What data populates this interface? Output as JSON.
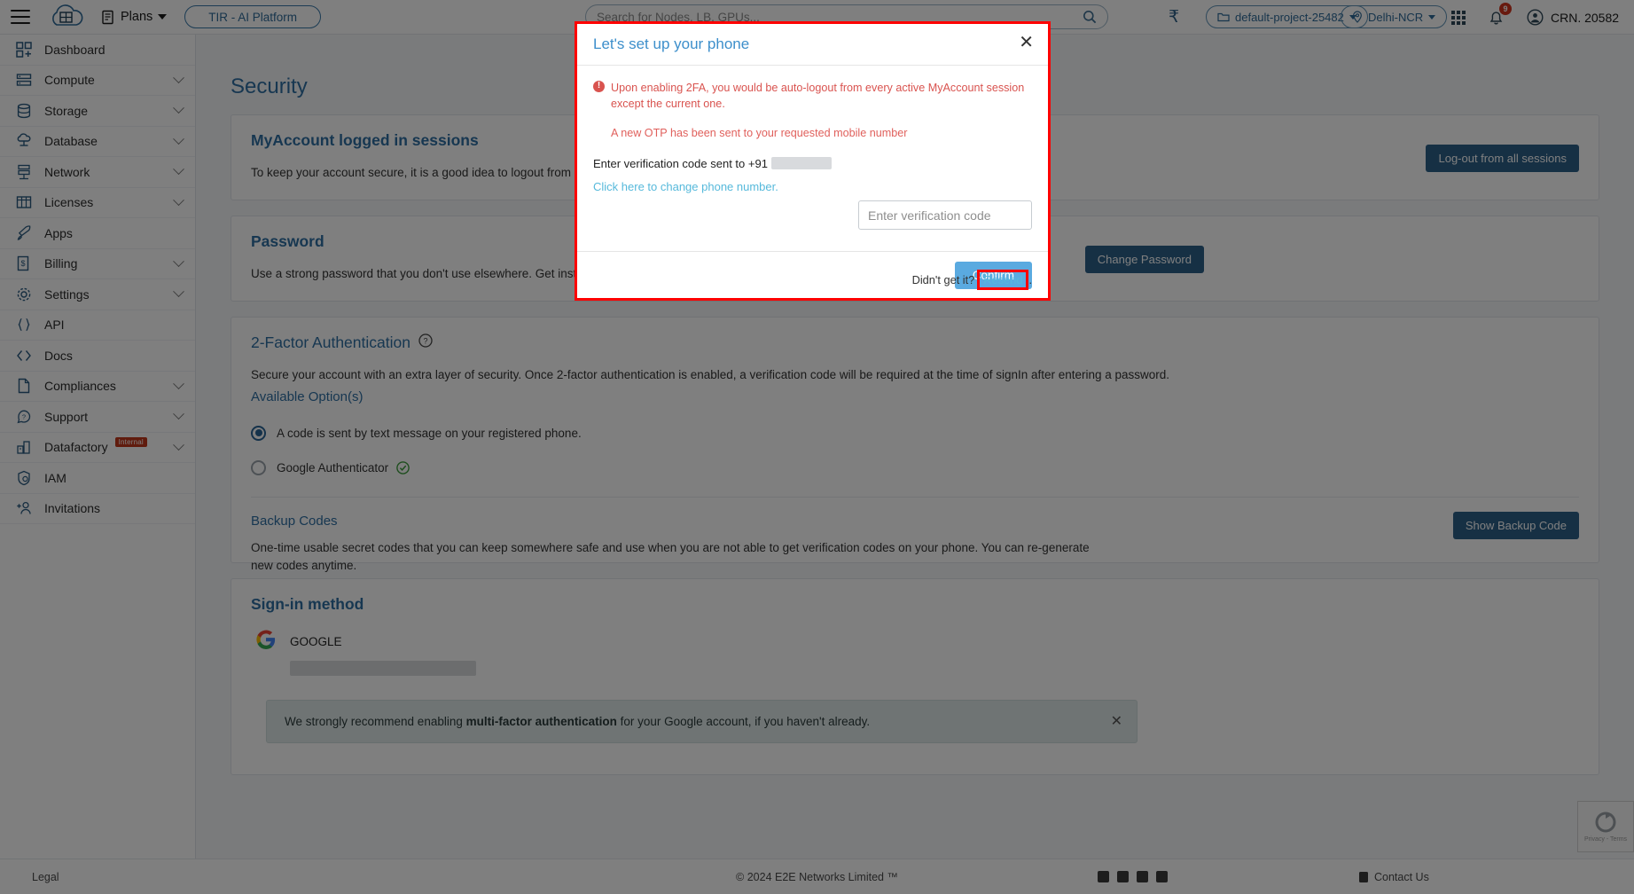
{
  "topbar": {
    "menu_icon": "hamburger-icon",
    "logo": "e2e-cloud-logo",
    "plans_label": "Plans",
    "tir_label": "TIR - AI Platform",
    "search_placeholder": "Search for Nodes, LB, GPUs...",
    "search_value": "",
    "currency_icon": "rupee-icon",
    "project_label": "default-project-25482",
    "region_label": "Delhi-NCR",
    "apps_icon": "grid-apps-icon",
    "bell_icon": "bell-icon",
    "notification_count": "9",
    "account_label": "CRN. 20582"
  },
  "sidebar": {
    "items": [
      {
        "label": "Dashboard",
        "icon": "dashboard-icon",
        "expandable": false
      },
      {
        "label": "Compute",
        "icon": "server-icon",
        "expandable": true
      },
      {
        "label": "Storage",
        "icon": "database-disk-icon",
        "expandable": true
      },
      {
        "label": "Database",
        "icon": "cloud-db-icon",
        "expandable": true
      },
      {
        "label": "Network",
        "icon": "network-icon",
        "expandable": true
      },
      {
        "label": "Licenses",
        "icon": "license-grid-icon",
        "expandable": true
      },
      {
        "label": "Apps",
        "icon": "rocket-icon",
        "expandable": false
      },
      {
        "label": "Billing",
        "icon": "invoice-icon",
        "expandable": true
      },
      {
        "label": "Settings",
        "icon": "gear-icon",
        "expandable": true
      },
      {
        "label": "API",
        "icon": "braces-icon",
        "expandable": false
      },
      {
        "label": "Docs",
        "icon": "code-icon",
        "expandable": false
      },
      {
        "label": "Compliances",
        "icon": "document-icon",
        "expandable": true
      },
      {
        "label": "Support",
        "icon": "help-chat-icon",
        "expandable": true
      },
      {
        "label": "Datafactory",
        "icon": "factory-icon",
        "expandable": true,
        "badge": "Internal"
      },
      {
        "label": "IAM",
        "icon": "shield-lock-icon",
        "expandable": false
      },
      {
        "label": "Invitations",
        "icon": "add-user-icon",
        "expandable": false
      }
    ]
  },
  "main": {
    "page_title": "Security",
    "sessions": {
      "heading": "MyAccount logged in sessions",
      "text": "To keep your account secure, it is a good idea to logout from sessions you don't recognise or no longer use.",
      "button": "Log-out from all sessions"
    },
    "password": {
      "heading": "Password",
      "text": "Use a strong password that you don't use elsewhere. Get instructions on how to create a strong password.",
      "button": "Change Password"
    },
    "twofa": {
      "heading": "2-Factor Authentication",
      "help_icon": "question-circle-icon",
      "description": "Secure your account with an extra layer of security. Once 2-factor authentication is enabled, a verification code will be required at the time of signIn after entering a password.",
      "options_label": "Available Option(s)",
      "options": [
        {
          "label": "A code is sent by text message on your registered phone.",
          "selected": true,
          "verified": false
        },
        {
          "label": "Google Authenticator",
          "selected": false,
          "verified": true
        }
      ],
      "backup": {
        "heading": "Backup Codes",
        "text": "One-time usable secret codes that you can keep somewhere safe and use when you are not able to get verification codes on your phone. You can re-generate new codes anytime.",
        "button": "Show Backup Code"
      }
    },
    "signin": {
      "heading": "Sign-in method",
      "provider": "GOOGLE",
      "account_redacted": true
    },
    "notice": {
      "text_before": "We strongly recommend enabling ",
      "text_bold": "multi-factor authentication",
      "text_after": " for your Google account, if you haven't already.",
      "close_icon": "close-icon"
    }
  },
  "modal": {
    "title": "Let's set up your phone",
    "close_icon": "close-icon",
    "warning_icon": "info-alert-icon",
    "warning": "Upon enabling 2FA, you would be auto-logout from every active MyAccount session except the current one.",
    "otp_sent": "A new OTP has been sent to your requested mobile number",
    "label": "Enter verification code sent to +91",
    "change_phone_link": "Click here to change phone number.",
    "input_placeholder": "Enter verification code",
    "input_value": "",
    "didnt_get_it": "Didn't get it?",
    "resend": "Resend",
    "resend_suffix": ".",
    "confirm": "Confirm"
  },
  "footer": {
    "legal": "Legal",
    "copyright": "© 2024 E2E Networks Limited ™",
    "social": [
      "linkedin-icon",
      "facebook-icon",
      "twitter-icon",
      "rss-icon"
    ],
    "contact": "Contact Us",
    "contact_icon": "phone-icon"
  },
  "recaptcha": {
    "label": "reCAPTCHA",
    "terms": "Privacy - Terms"
  },
  "colors": {
    "accent_blue": "#2e6fa3",
    "button_dark": "#2d6189",
    "danger_red": "#d9534f",
    "link_cyan": "#56b9db",
    "highlight_red": "#ff0000"
  }
}
